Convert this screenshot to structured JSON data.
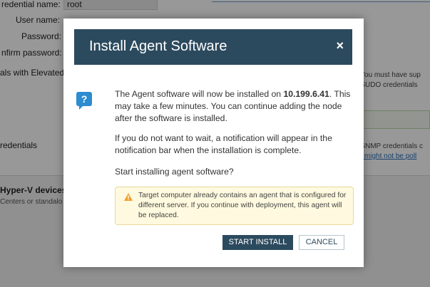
{
  "background": {
    "form": {
      "credential_name_label": "redential name:",
      "credential_name_value": "root",
      "user_name_label": "User name:",
      "password_label": "Password:",
      "confirm_password_label": "nfirm password:",
      "elevated_label": "als with Elevated",
      "credentials_label": "redentials"
    },
    "right_notes": {
      "sudo_line1": "? You must have sup",
      "sudo_line2": "u SUDO credentials",
      "snmp_line1": "? SNMP credentials c",
      "snmp_line2": "on might not be poll"
    },
    "section": {
      "heading": "Hyper-V devices",
      "subtext": "Centers or standalo"
    }
  },
  "dialog": {
    "title": "Install Agent Software",
    "close_glyph": "×",
    "help_glyph": "?",
    "message_prefix": "The Agent software will now be installed on ",
    "ip_address": "10.199.6.41",
    "message_suffix": ". This may take a few minutes. You can continue adding the node after the software is installed.",
    "notification_text": "If you do not want to wait, a notification will appear in the notification bar when the installation is complete.",
    "question": "Start installing agent software?",
    "warning": "Target computer already contains an agent that is configured for different server. If you continue with deployment, this agent will be replaced.",
    "start_button": "START INSTALL",
    "cancel_button": "CANCEL"
  },
  "colors": {
    "header": "#2c4a5e",
    "primary_button": "#2c4a5e",
    "help_icon": "#2d8ccf",
    "warning_bg": "#fffadf",
    "warning_icon": "#f0a030"
  },
  "icons": {
    "help": "help-bubble-icon",
    "close": "close-icon",
    "warning": "warning-triangle-icon"
  }
}
